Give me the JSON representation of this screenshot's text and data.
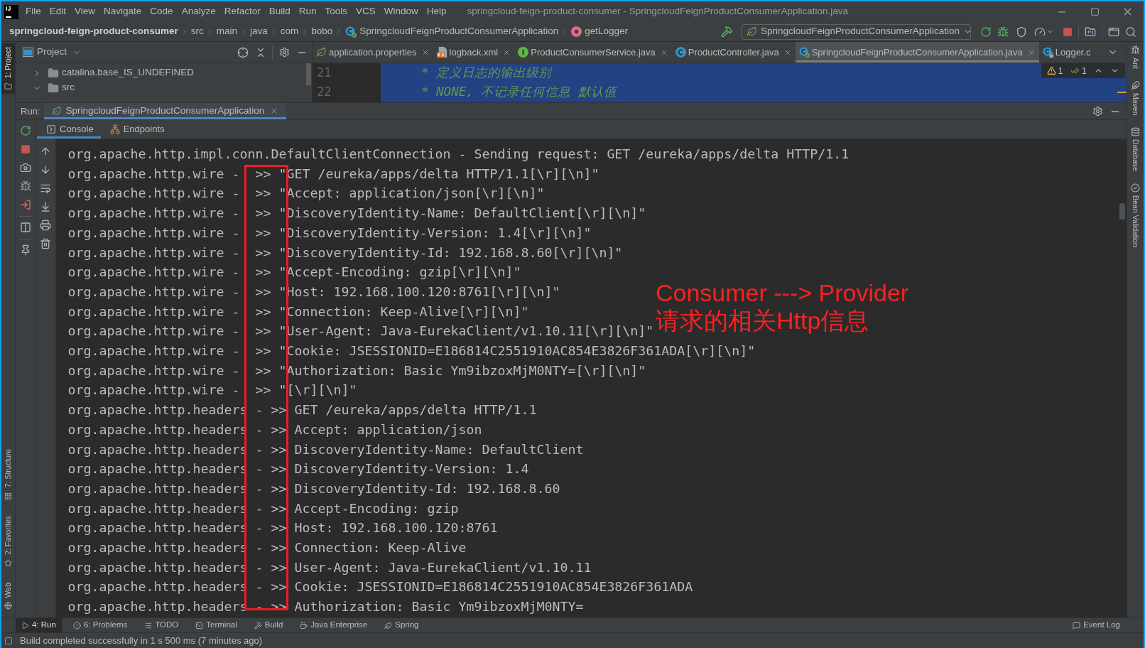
{
  "app_logo": "IJ",
  "menu": [
    "File",
    "Edit",
    "View",
    "Navigate",
    "Code",
    "Analyze",
    "Refactor",
    "Build",
    "Run",
    "Tools",
    "VCS",
    "Window",
    "Help"
  ],
  "window": {
    "title": "springcloud-feign-product-consumer - SpringcloudFeignProductConsumerApplication.java"
  },
  "breadcrumbs": [
    {
      "label": "springcloud-feign-product-consumer",
      "kind": "project"
    },
    {
      "label": "src",
      "kind": "folder"
    },
    {
      "label": "main",
      "kind": "folder"
    },
    {
      "label": "java",
      "kind": "folder"
    },
    {
      "label": "com",
      "kind": "folder"
    },
    {
      "label": "bobo",
      "kind": "folder"
    },
    {
      "label": "SpringcloudFeignProductConsumerApplication",
      "kind": "class"
    },
    {
      "label": "getLogger",
      "kind": "method"
    }
  ],
  "run_configuration": {
    "label": "SpringcloudFeignProductConsumerApplication"
  },
  "left_tool_strip": {
    "top": [
      {
        "label": "1: Project",
        "kind": "project",
        "selected": true
      }
    ],
    "bottom": [
      {
        "label": "7: Structure",
        "kind": "structure",
        "selected": false
      },
      {
        "label": "2: Favorites",
        "kind": "favorites",
        "selected": false
      },
      {
        "label": "Web",
        "kind": "web",
        "selected": false
      }
    ]
  },
  "project_panel": {
    "title": "Project",
    "tree": [
      {
        "label": "catalina.base_IS_UNDEFINED",
        "expanded": false
      },
      {
        "label": "src",
        "expanded": true
      }
    ]
  },
  "editor_tabs": [
    {
      "label": "application.properties",
      "kind": "properties",
      "selected": false,
      "closable": true
    },
    {
      "label": "logback.xml",
      "kind": "xml",
      "selected": false,
      "closable": true
    },
    {
      "label": "ProductConsumerService.java",
      "kind": "interface",
      "selected": false,
      "closable": true
    },
    {
      "label": "ProductController.java",
      "kind": "class",
      "selected": false,
      "closable": true
    },
    {
      "label": "SpringcloudFeignProductConsumerApplication.java",
      "kind": "spring_class",
      "selected": true,
      "closable": true
    },
    {
      "label": "Logger.c",
      "kind": "library_class",
      "selected": false,
      "closable": false
    }
  ],
  "editor": {
    "lines": [
      {
        "number": "21",
        "code": "* 定义日志的输出级别"
      },
      {
        "number": "22",
        "code": "* NONE, 不记录任何信息 默认值"
      }
    ],
    "inspections": [
      {
        "kind": "warning",
        "count": "1"
      },
      {
        "kind": "check",
        "count": "1"
      }
    ]
  },
  "right_tool_strip": [
    {
      "label": "Ant",
      "kind": "ant"
    },
    {
      "label": "Maven",
      "kind": "maven"
    },
    {
      "label": "Database",
      "kind": "database"
    },
    {
      "label": "Bean Validation",
      "kind": "validation"
    }
  ],
  "run_panel": {
    "label": "Run:",
    "tabs": [
      {
        "label": "SpringcloudFeignProductConsumerApplication",
        "selected": true
      }
    ],
    "subtabs": [
      {
        "label": "Console",
        "kind": "console",
        "selected": true
      },
      {
        "label": "Endpoints",
        "kind": "endpoints",
        "selected": false
      }
    ],
    "console_lines": [
      "org.apache.http.impl.conn.DefaultClientConnection - Sending request: GET /eureka/apps/delta HTTP/1.1",
      "org.apache.http.wire -  >> \"GET /eureka/apps/delta HTTP/1.1[\\r][\\n]\"",
      "org.apache.http.wire -  >> \"Accept: application/json[\\r][\\n]\"",
      "org.apache.http.wire -  >> \"DiscoveryIdentity-Name: DefaultClient[\\r][\\n]\"",
      "org.apache.http.wire -  >> \"DiscoveryIdentity-Version: 1.4[\\r][\\n]\"",
      "org.apache.http.wire -  >> \"DiscoveryIdentity-Id: 192.168.8.60[\\r][\\n]\"",
      "org.apache.http.wire -  >> \"Accept-Encoding: gzip[\\r][\\n]\"",
      "org.apache.http.wire -  >> \"Host: 192.168.100.120:8761[\\r][\\n]\"",
      "org.apache.http.wire -  >> \"Connection: Keep-Alive[\\r][\\n]\"",
      "org.apache.http.wire -  >> \"User-Agent: Java-EurekaClient/v1.10.11[\\r][\\n]\"",
      "org.apache.http.wire -  >> \"Cookie: JSESSIONID=E186814C2551910AC854E3826F361ADA[\\r][\\n]\"",
      "org.apache.http.wire -  >> \"Authorization: Basic Ym9ibzoxMjM0NTY=[\\r][\\n]\"",
      "org.apache.http.wire -  >> \"[\\r][\\n]\"",
      "org.apache.http.headers - >> GET /eureka/apps/delta HTTP/1.1",
      "org.apache.http.headers - >> Accept: application/json",
      "org.apache.http.headers - >> DiscoveryIdentity-Name: DefaultClient",
      "org.apache.http.headers - >> DiscoveryIdentity-Version: 1.4",
      "org.apache.http.headers - >> DiscoveryIdentity-Id: 192.168.8.60",
      "org.apache.http.headers - >> Accept-Encoding: gzip",
      "org.apache.http.headers - >> Host: 192.168.100.120:8761",
      "org.apache.http.headers - >> Connection: Keep-Alive",
      "org.apache.http.headers - >> User-Agent: Java-EurekaClient/v1.10.11",
      "org.apache.http.headers - >> Cookie: JSESSIONID=E186814C2551910AC854E3826F361ADA",
      "org.apache.http.headers - >> Authorization: Basic Ym9ibzoxMjM0NTY="
    ]
  },
  "annotation": [
    "Consumer ---> Provider",
    "请求的相关Http信息"
  ],
  "bottom_tool_bar": [
    {
      "label": "4: Run",
      "kind": "run",
      "selected": true
    },
    {
      "label": "6: Problems",
      "kind": "problems",
      "selected": false
    },
    {
      "label": "TODO",
      "kind": "todo",
      "selected": false
    },
    {
      "label": "Terminal",
      "kind": "terminal",
      "selected": false
    },
    {
      "label": "Build",
      "kind": "build",
      "selected": false
    },
    {
      "label": "Java Enterprise",
      "kind": "java_enterprise",
      "selected": false
    },
    {
      "label": "Spring",
      "kind": "spring",
      "selected": false
    }
  ],
  "event_log": "Event Log",
  "status_bar": {
    "message": "Build completed successfully in 1 s 500 ms (7 minutes ago)"
  }
}
